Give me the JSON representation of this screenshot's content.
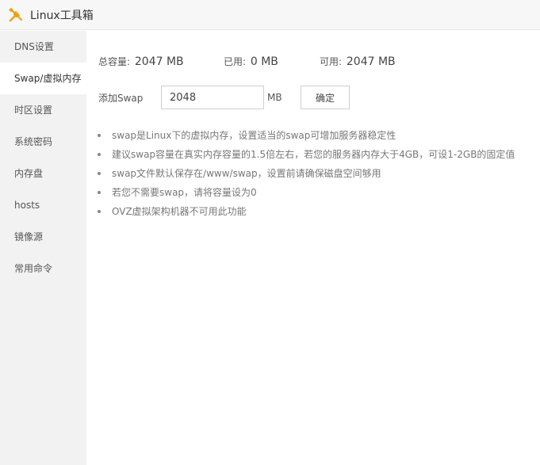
{
  "app": {
    "title": "Linux工具箱",
    "logo_icon": "tools-icon",
    "accent": "#e8a317"
  },
  "sidebar": {
    "items": [
      {
        "label": "DNS设置",
        "active": false
      },
      {
        "label": "Swap/虚拟内存",
        "active": true
      },
      {
        "label": "时区设置",
        "active": false
      },
      {
        "label": "系统密码",
        "active": false
      },
      {
        "label": "内存盘",
        "active": false
      },
      {
        "label": "hosts",
        "active": false
      },
      {
        "label": "镜像源",
        "active": false
      },
      {
        "label": "常用命令",
        "active": false
      }
    ]
  },
  "swap": {
    "total_label": "总容量:",
    "total_value": "2047 MB",
    "used_label": "已用:",
    "used_value": "0 MB",
    "free_label": "可用:",
    "free_value": "2047 MB",
    "add_label": "添加Swap",
    "input_value": "2048",
    "unit": "MB",
    "confirm_label": "确定"
  },
  "tips": [
    "swap是Linux下的虚拟内存，设置适当的swap可增加服务器稳定性",
    "建议swap容量在真实内存容量的1.5倍左右，若您的服务器内存大于4GB，可设1-2GB的固定值",
    "swap文件默认保存在/www/swap，设置前请确保磁盘空间够用",
    "若您不需要swap，请将容量设为0",
    "OVZ虚拟架构机器不可用此功能"
  ]
}
